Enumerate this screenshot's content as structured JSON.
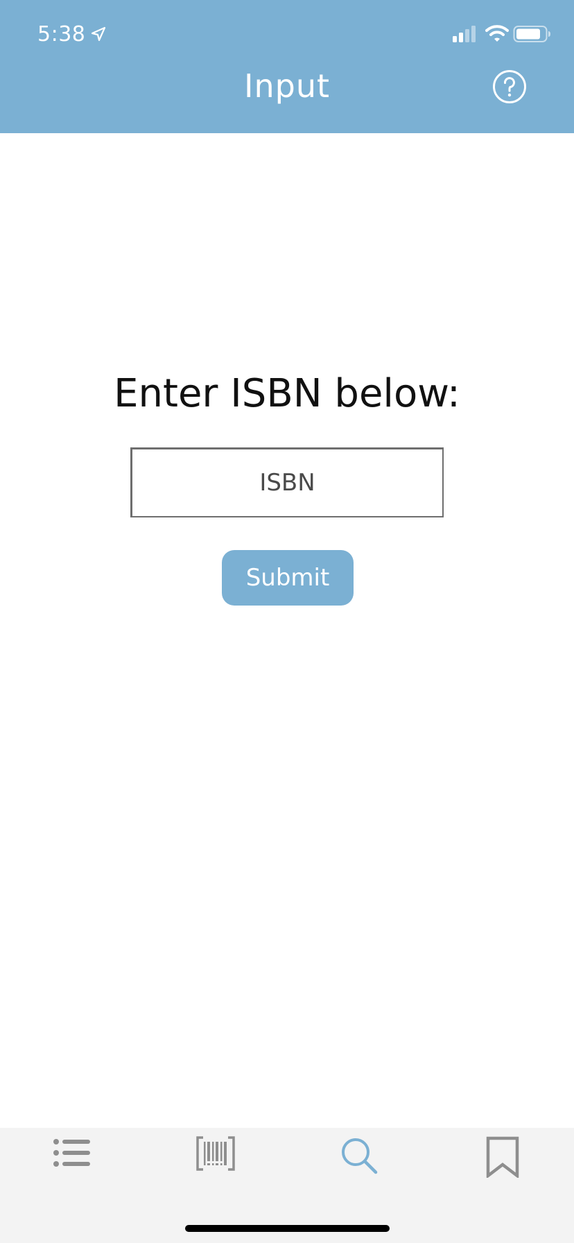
{
  "status_bar": {
    "time": "5:38",
    "icons": [
      "location-arrow-icon",
      "cellular-signal-icon",
      "wifi-icon",
      "battery-icon"
    ]
  },
  "header": {
    "title": "Input",
    "help_icon": "question-circle-icon"
  },
  "main": {
    "prompt": "Enter ISBN below:",
    "input": {
      "placeholder": "ISBN",
      "value": ""
    },
    "submit_label": "Submit"
  },
  "tab_bar": {
    "items": [
      {
        "icon": "list-icon",
        "active": false
      },
      {
        "icon": "barcode-scan-icon",
        "active": false
      },
      {
        "icon": "search-icon",
        "active": true
      },
      {
        "icon": "bookmark-icon",
        "active": false
      }
    ]
  },
  "colors": {
    "accent": "#7bb0d3",
    "tab_inactive": "#8e8e8e",
    "tab_bar_bg": "#f3f3f3"
  }
}
